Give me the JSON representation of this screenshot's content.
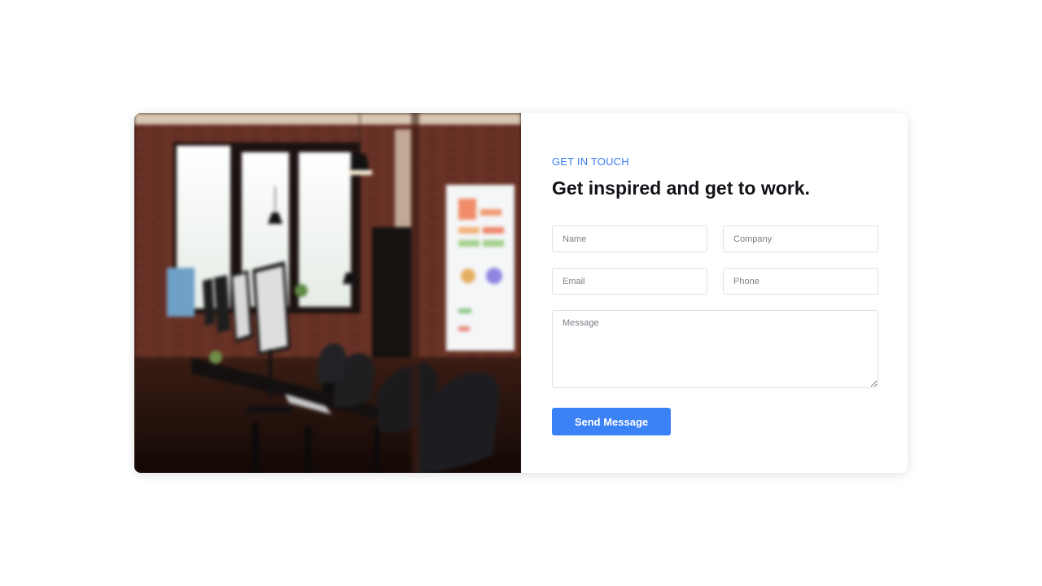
{
  "contact": {
    "eyebrow": "GET IN TOUCH",
    "headline": "Get inspired and get to work.",
    "fields": {
      "name_placeholder": "Name",
      "company_placeholder": "Company",
      "email_placeholder": "Email",
      "phone_placeholder": "Phone",
      "message_placeholder": "Message"
    },
    "submit_label": "Send Message"
  },
  "image": {
    "description_name": "office-workspace-photo"
  },
  "colors": {
    "accent": "#3b82f6",
    "eyebrow": "#3b7cf0",
    "heading": "#111318",
    "border": "#dfe2e6"
  }
}
